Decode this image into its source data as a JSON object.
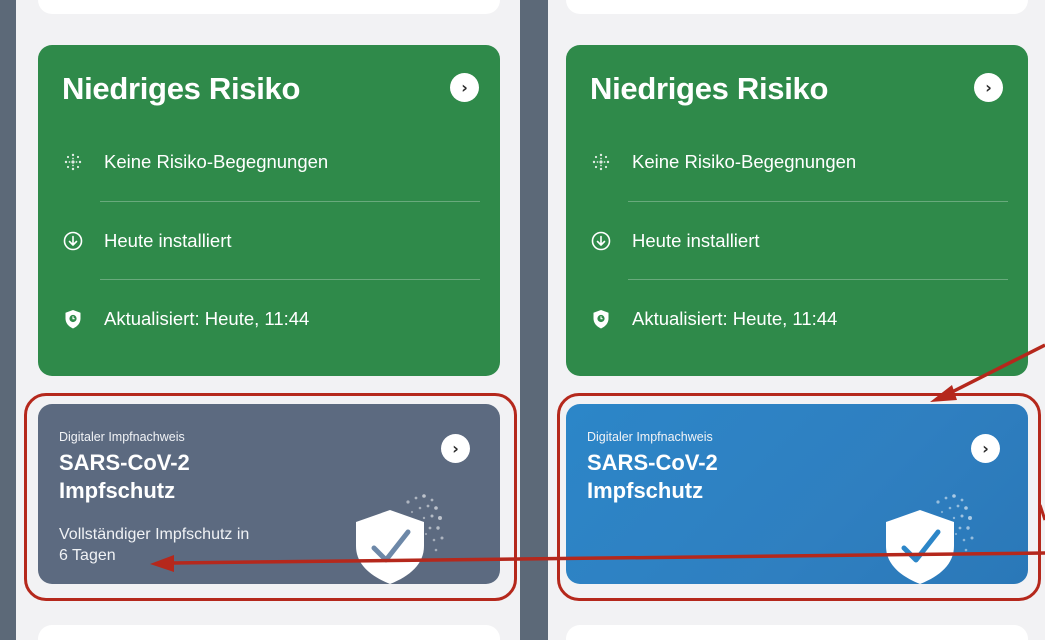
{
  "colors": {
    "risk_green": "#2f8a4a",
    "vaccine_gray": "#5c6a80",
    "vaccine_blue": "#2c86c8",
    "annotation_red": "#b5281c",
    "divider": "#5c6978"
  },
  "screens": [
    {
      "risk_card": {
        "title": "Niedriges Risiko",
        "rows": [
          {
            "icon": "exposure-icon",
            "text": "Keine Risiko-Begegnungen"
          },
          {
            "icon": "download-icon",
            "text": "Heute installiert"
          },
          {
            "icon": "shield-clock-icon",
            "text": "Aktualisiert: Heute, 11:44"
          }
        ]
      },
      "vaccination_card": {
        "kicker": "Digitaler Impfnachweis",
        "title_line1": "SARS-CoV-2",
        "title_line2": "Impfschutz",
        "desc_line1": "Vollständiger Impfschutz in",
        "desc_line2": "6 Tagen"
      }
    },
    {
      "risk_card": {
        "title": "Niedriges Risiko",
        "rows": [
          {
            "icon": "exposure-icon",
            "text": "Keine Risiko-Begegnungen"
          },
          {
            "icon": "download-icon",
            "text": "Heute installiert"
          },
          {
            "icon": "shield-clock-icon",
            "text": "Aktualisiert: Heute, 11:44"
          }
        ]
      },
      "vaccination_card": {
        "kicker": "Digitaler Impfnachweis",
        "title_line1": "SARS-CoV-2",
        "title_line2": "Impfschutz"
      }
    }
  ]
}
